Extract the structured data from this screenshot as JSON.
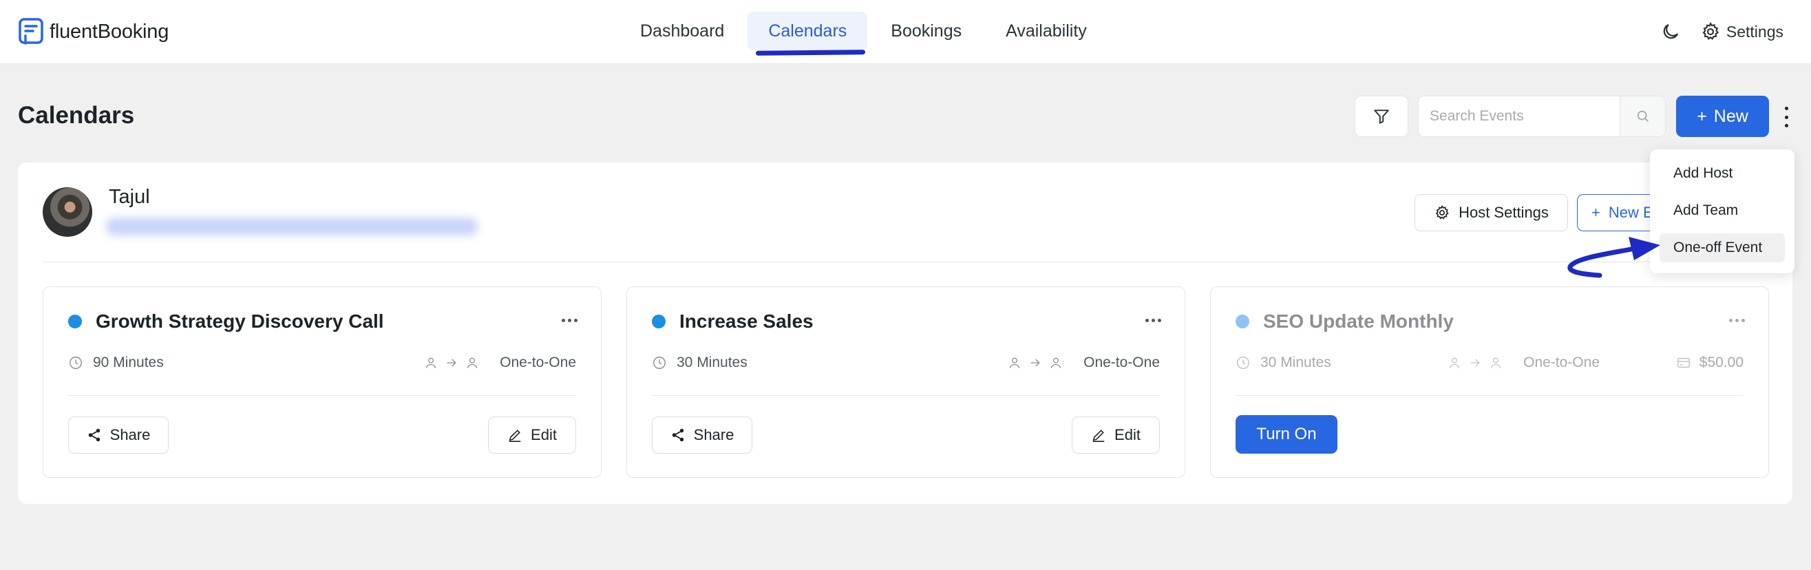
{
  "brand": {
    "name_part1": "fluent",
    "name_part2": "Booking"
  },
  "nav": {
    "items": [
      {
        "label": "Dashboard",
        "active": false
      },
      {
        "label": "Calendars",
        "active": true
      },
      {
        "label": "Bookings",
        "active": false
      },
      {
        "label": "Availability",
        "active": false
      }
    ]
  },
  "topbar": {
    "theme_icon": "moon-icon",
    "settings_label": "Settings"
  },
  "page": {
    "title": "Calendars",
    "search_placeholder": "Search Events",
    "new_label": "New"
  },
  "host": {
    "name": "Tajul",
    "settings_label": "Host Settings",
    "new_event_label": "New Event"
  },
  "events": [
    {
      "title": "Growth Strategy Discovery Call",
      "duration": "90 Minutes",
      "type": "One-to-One",
      "share_label": "Share",
      "edit_label": "Edit",
      "dot_color": "#1a8fe3"
    },
    {
      "title": "Increase Sales",
      "duration": "30 Minutes",
      "type": "One-to-One",
      "share_label": "Share",
      "edit_label": "Edit",
      "dot_color": "#1a8fe3"
    },
    {
      "title": "SEO Update Monthly",
      "duration": "30 Minutes",
      "type": "One-to-One",
      "price": "$50.00",
      "turn_on_label": "Turn On",
      "dot_color": "#8cc4f2"
    }
  ],
  "dropdown": {
    "items": [
      {
        "label": "Add Host"
      },
      {
        "label": "Add Team"
      },
      {
        "label": "One-off Event"
      }
    ]
  },
  "colors": {
    "primary": "#2767e1",
    "annotation_arrow": "#1d2bc4"
  }
}
